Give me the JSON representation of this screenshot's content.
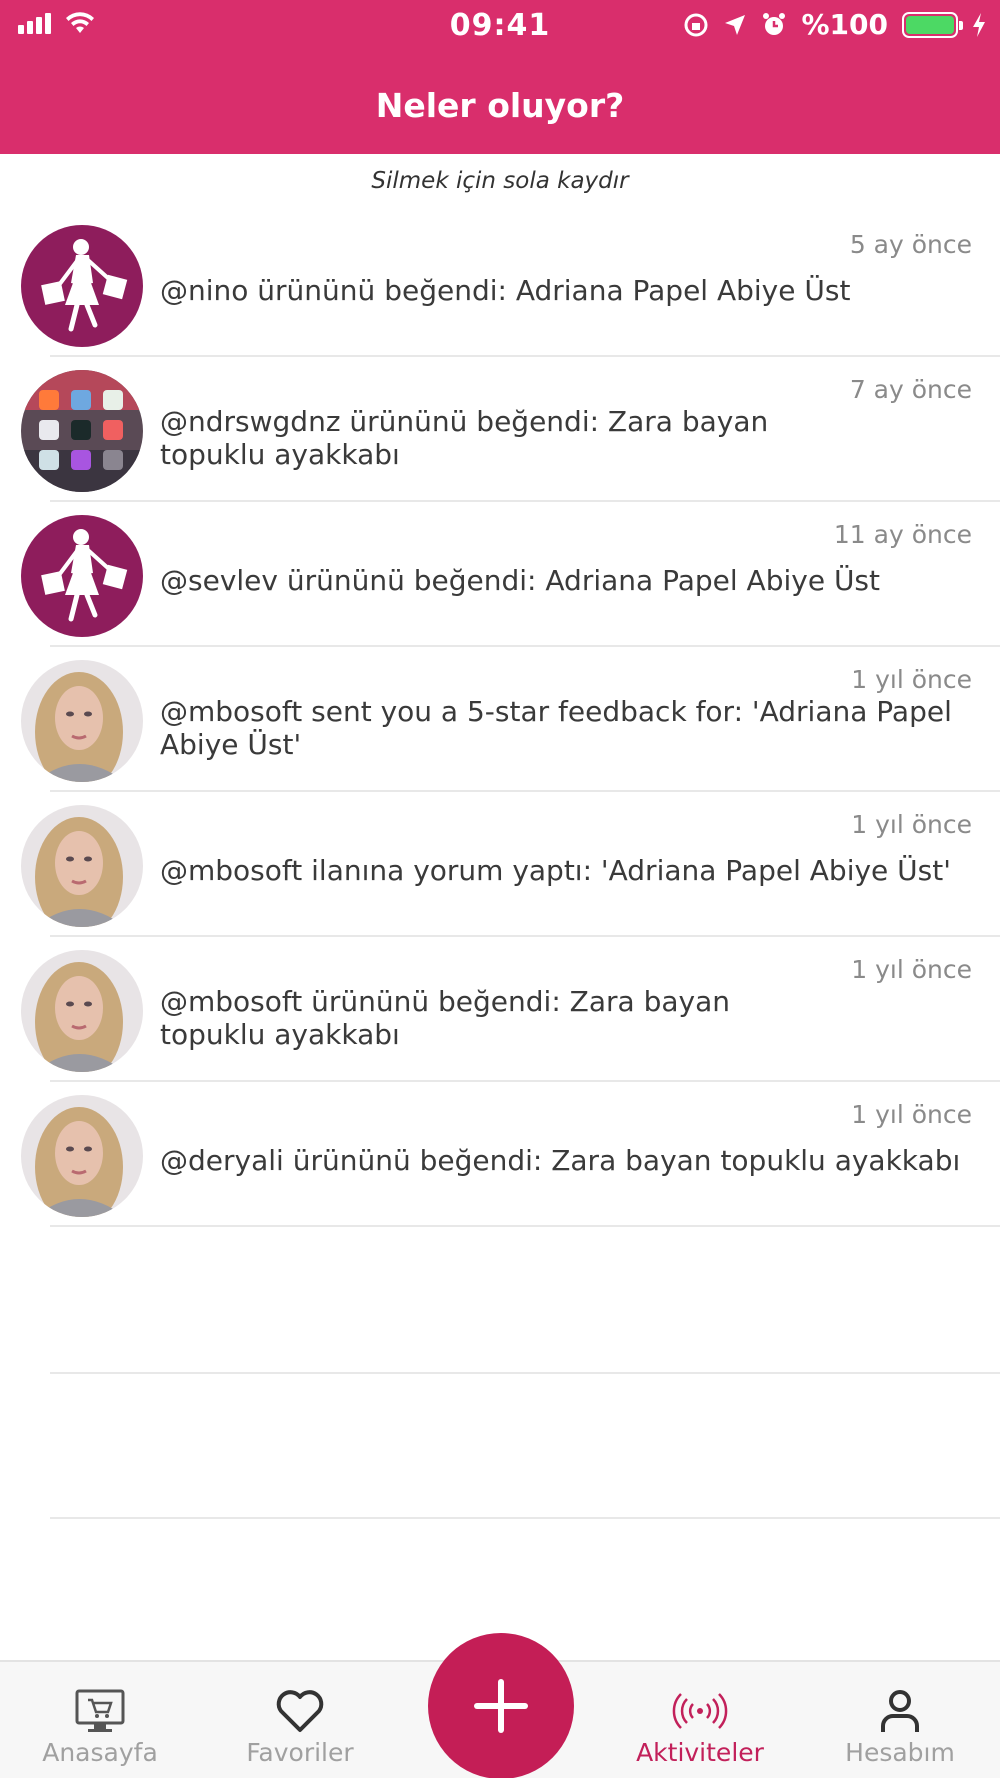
{
  "status_bar": {
    "time": "09:41",
    "battery_text": "%100"
  },
  "header": {
    "title": "Neler oluyor?"
  },
  "hint": "Silmek için sola kaydır",
  "activities": [
    {
      "avatar": "shopping-woman-logo",
      "time_ago": "5 ay önce",
      "message": "@nino ürününü beğendi: Adriana Papel Abiye Üst"
    },
    {
      "avatar": "app-icons-photo",
      "time_ago": "7 ay önce",
      "message": "@ndrswgdnz ürününü beğendi: Zara bayan topuklu ayakkabı"
    },
    {
      "avatar": "shopping-woman-logo",
      "time_ago": "11 ay önce",
      "message": "@sevlev ürününü beğendi: Adriana Papel Abiye Üst"
    },
    {
      "avatar": "user-photo",
      "time_ago": "1 yıl önce",
      "message": "@mbosoft sent you a 5-star feedback for: 'Adriana Papel Abiye Üst'"
    },
    {
      "avatar": "user-photo",
      "time_ago": "1 yıl önce",
      "message": "@mbosoft ilanına yorum yaptı: 'Adriana Papel Abiye Üst'"
    },
    {
      "avatar": "user-photo",
      "time_ago": "1 yıl önce",
      "message": "@mbosoft ürününü beğendi: Zara bayan topuklu ayakkabı"
    },
    {
      "avatar": "user-photo",
      "time_ago": "1 yıl önce",
      "message": "@deryali ürününü beğendi: Zara bayan topuklu ayakkabı"
    }
  ],
  "tabbar": {
    "tabs": [
      {
        "label": "Anasayfa",
        "icon": "store-monitor-icon"
      },
      {
        "label": "Favoriler",
        "icon": "heart-icon"
      },
      {
        "label": "Aktiviteler",
        "icon": "broadcast-icon",
        "active": true
      },
      {
        "label": "Hesabım",
        "icon": "user-icon"
      }
    ],
    "fab_icon": "plus-icon"
  },
  "colors": {
    "brand": "#d92e6c",
    "fab": "#c41e56",
    "active_tab": "#c2205a",
    "logo_bg": "#8e1d5c"
  }
}
